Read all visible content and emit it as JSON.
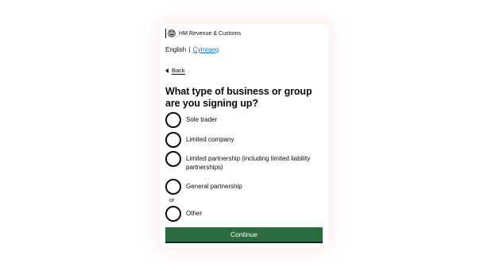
{
  "header": {
    "department": "HM Revenue & Customs",
    "crest_icon": "crest-icon"
  },
  "language": {
    "current": "English",
    "separator": "|",
    "alternate": "Cymraeg"
  },
  "nav": {
    "back_label": "Back"
  },
  "question": {
    "title": "What type of business or group are you signing up?"
  },
  "options": [
    {
      "label": "Sole trader",
      "selected": false
    },
    {
      "label": "Limited company",
      "selected": false
    },
    {
      "label": "Limited partnership (including limited liability partnerships)",
      "selected": false
    },
    {
      "label": "General partnership",
      "selected": false
    },
    {
      "label": "Other",
      "selected": false
    }
  ],
  "divider_text": "or",
  "actions": {
    "continue_label": "Continue"
  },
  "colors": {
    "button": "#2c6b3f",
    "link": "#1d70b8",
    "text": "#0b0c0c"
  }
}
